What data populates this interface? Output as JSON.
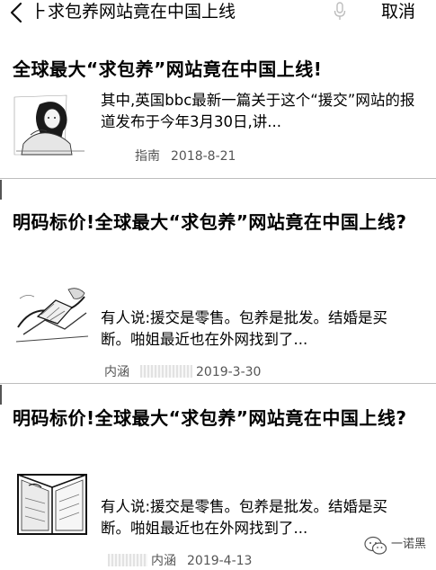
{
  "search": {
    "query": "求包养网站竟在中国上线",
    "cursor_char": "⺊",
    "cancel_label": "取消"
  },
  "results": [
    {
      "title": "全球最大“求包养”网站竟在中国上线!",
      "snippet": "其中,英国bbc最新一篇关于这个“援交”网站的报道发布于今年3月30日,讲...",
      "source": "指南",
      "date": "2018-8-21",
      "thumb_icon": "woman-illustration-icon"
    },
    {
      "title": "明码标价!全球最大“求包养”网站竟在中国上线?",
      "snippet": "有人说:援交是零售。包养是批发。结婚是买断。啪姐最近也在外网找到了...",
      "source": "内涵",
      "date": "2019-3-30",
      "thumb_icon": "sketch-illustration-icon"
    },
    {
      "title": "明码标价!全球最大“求包养”网站竟在中国上线?",
      "snippet": "有人说:援交是零售。包养是批发。结婚是买断。啪姐最近也在外网找到了...",
      "source": "内涵",
      "date": "2019-4-13",
      "thumb_icon": "book-illustration-icon"
    }
  ],
  "watermark": {
    "label": "一诺黑"
  }
}
